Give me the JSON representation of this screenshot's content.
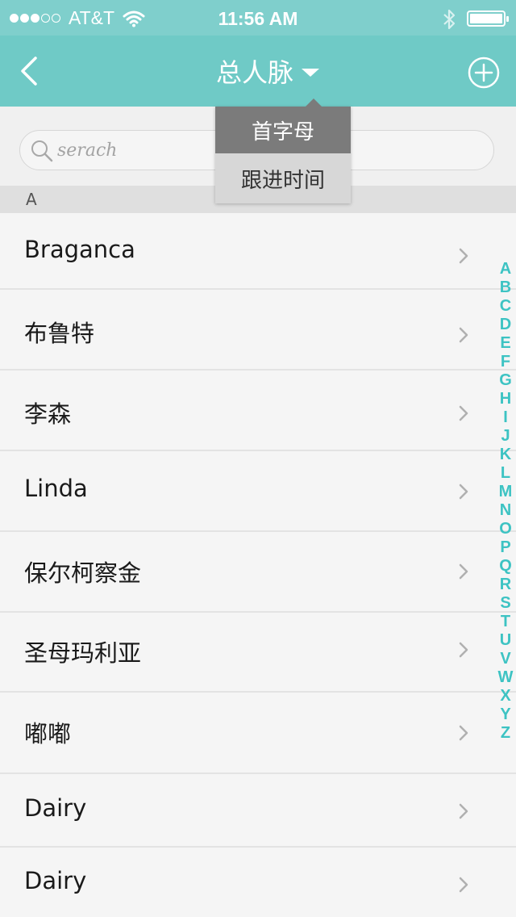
{
  "status_bar": {
    "carrier": "AT&T",
    "time": "11:56 AM",
    "signal_filled": 3,
    "signal_total": 5
  },
  "nav": {
    "title": "总人脉",
    "back_icon": "chevron-left-icon",
    "add_icon": "plus-circle-icon",
    "colors": {
      "bar": "#6fcac6",
      "status": "#7fcfcc"
    }
  },
  "search": {
    "placeholder": "serach",
    "value": ""
  },
  "sort_menu": {
    "options": [
      "首字母",
      "跟进时间"
    ],
    "selected": "首字母"
  },
  "section": {
    "header": "A"
  },
  "contacts": [
    {
      "name": "Braganca"
    },
    {
      "name": "布鲁特"
    },
    {
      "name": "李森"
    },
    {
      "name": "Linda"
    },
    {
      "name": "保尔柯察金"
    },
    {
      "name": "圣母玛利亚"
    },
    {
      "name": "嘟嘟"
    },
    {
      "name": "Dairy"
    },
    {
      "name": "Dairy"
    }
  ],
  "index_letters": [
    "A",
    "B",
    "C",
    "D",
    "E",
    "F",
    "G",
    "H",
    "I",
    "J",
    "K",
    "L",
    "M",
    "N",
    "O",
    "P",
    "Q",
    "R",
    "S",
    "T",
    "U",
    "V",
    "W",
    "X",
    "Y",
    "Z"
  ],
  "index_color": "#3dc3c3"
}
